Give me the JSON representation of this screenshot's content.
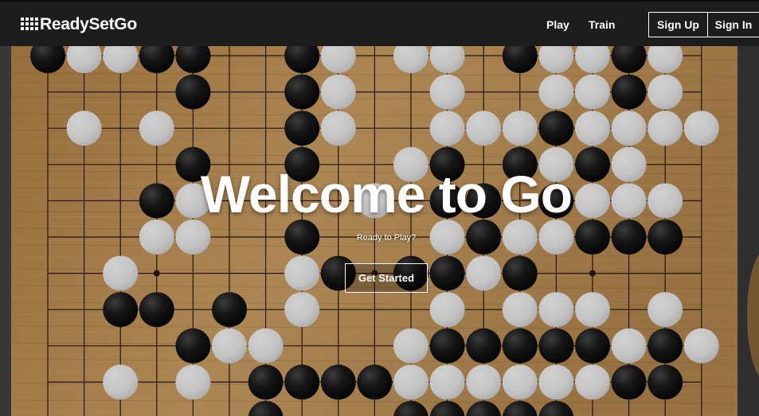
{
  "nav": {
    "brand": "ReadySetGo",
    "links": [
      "Play",
      "Train"
    ],
    "sign_up": "Sign Up",
    "sign_in": "Sign In"
  },
  "hero": {
    "title": "Welcome to Go",
    "subtitle": "Ready to Play?",
    "cta": "Get Started"
  },
  "colors": {
    "navbar_bg": "#1d1d1d",
    "board_wood": "#c89a5e",
    "black_stone": "#161616",
    "white_stone": "#f2f2f2"
  }
}
